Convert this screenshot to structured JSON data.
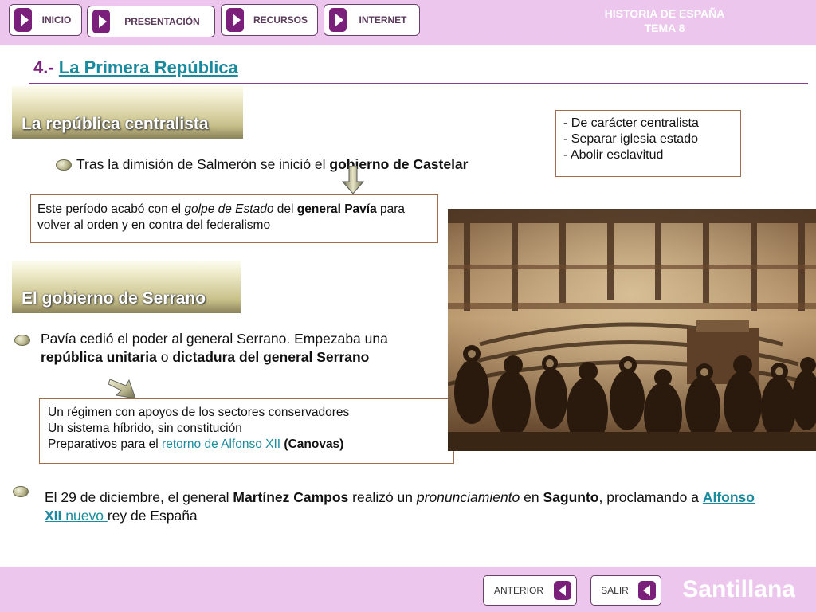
{
  "nav": {
    "inicio": "INICIO",
    "presentacion": "PRESENTACIÓN",
    "recursos": "RECURSOS",
    "internet": "INTERNET"
  },
  "course": {
    "line1": "HISTORIA DE ESPAÑA",
    "line2": "TEMA 8"
  },
  "title": {
    "number": "4.- ",
    "link": "La Primera República"
  },
  "section1": {
    "heading": "La república centralista",
    "bullet_pre": "Tras la dimisión de Salmerón se inició el ",
    "bullet_bold": "gobierno de Castelar",
    "features": [
      "- De carácter centralista",
      "- Separar iglesia estado",
      "- Abolir esclavitud"
    ],
    "box": {
      "t1": "Este período acabó con el ",
      "t2": "golpe de Estado",
      "t3": " del ",
      "t4": "general Pavía",
      "t5": " para volver al orden y en contra del federalismo"
    }
  },
  "section2": {
    "heading": "El gobierno de Serrano",
    "bullet": {
      "t1": "Pavía cedió el poder al general Serrano. Empezaba una ",
      "t2": "república unitaria",
      "t3": " o ",
      "t4": "dictadura del general Serrano"
    },
    "box": {
      "line1": "Un régimen con apoyos de los sectores conservadores",
      "line2": "Un sistema híbrido, sin constitución",
      "line3_pre": "Preparativos para el ",
      "line3_link": "retorno de Alfonso XII ",
      "line3_post": "(Canovas)"
    }
  },
  "final": {
    "t1": "El 29 de diciembre, el general ",
    "t2": "Martínez Campos",
    "t3": " realizó un ",
    "t4": "pronunciamiento",
    "t5": " en ",
    "t6": "Sagunto",
    "t7": ", proclamando a ",
    "t8": "Alfonso XII",
    "t9": " nuevo ",
    "t10": "rey de España"
  },
  "footer": {
    "anterior": "ANTERIOR",
    "salir": "SALIR",
    "brand": "Santillana"
  },
  "colors": {
    "bar": "#ecc6ec",
    "accent": "#7a1f7a",
    "link": "#1a8b9e",
    "box_border": "#a16b4e"
  }
}
